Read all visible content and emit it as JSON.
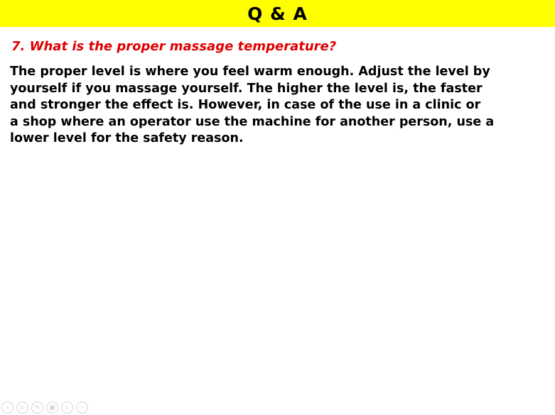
{
  "slide": {
    "title": "Q & A",
    "question": "7. What is the proper massage temperature?",
    "answer_lines": [
      "The proper level is where you feel warm enough. Adjust the level by",
      "yourself if you massage yourself. The higher the level is, the faster",
      "and stronger the effect is. However, in case of the use in a clinic or",
      "a shop where an operator use the machine for another person, use a",
      "lower level for the safety reason."
    ]
  },
  "colors": {
    "title_bar": "#ffff00",
    "question_text": "#e00000",
    "body_text": "#000000"
  },
  "controls": [
    {
      "icon": "previous-icon",
      "glyph": "‹"
    },
    {
      "icon": "play-icon",
      "glyph": "▷"
    },
    {
      "icon": "pen-icon",
      "glyph": "✎"
    },
    {
      "icon": "slides-icon",
      "glyph": "▣"
    },
    {
      "icon": "zoom-icon",
      "glyph": "⌕"
    },
    {
      "icon": "more-icon",
      "glyph": "⋯"
    }
  ]
}
